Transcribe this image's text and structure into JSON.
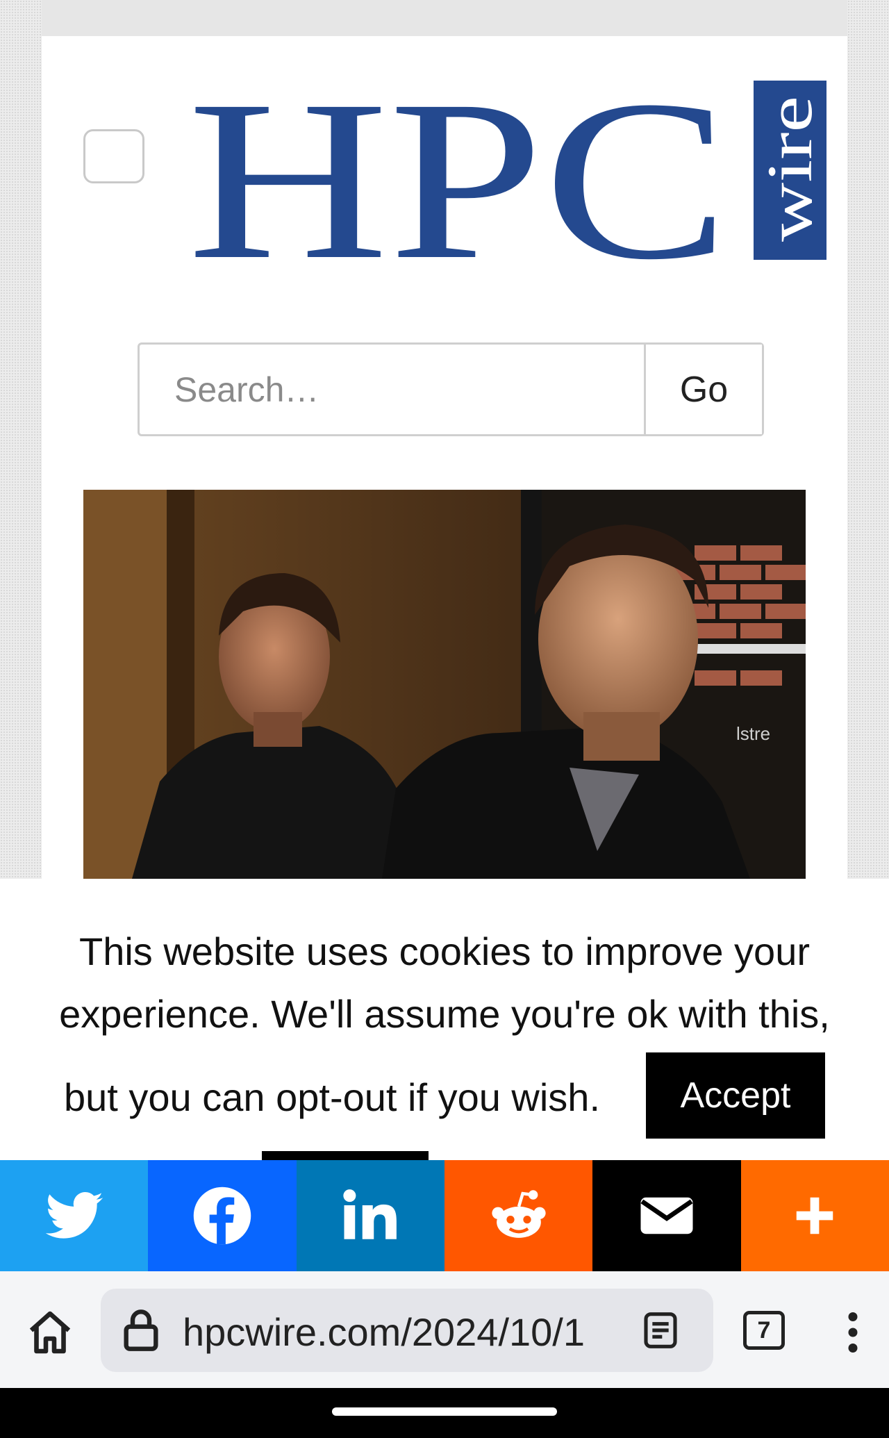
{
  "site": {
    "logo_main": "HPC",
    "logo_tag": "wire"
  },
  "search": {
    "placeholder": "Search…",
    "go_label": "Go"
  },
  "cookie": {
    "message_line1": "This website uses cookies to improve your",
    "message_line2": "experience. We'll assume you're ok with this,",
    "message_line3": "but you can opt-out if you wish.",
    "accept_label": "Accept"
  },
  "share": {
    "items": [
      {
        "icon": "twitter-icon",
        "color": "#1da1f2"
      },
      {
        "icon": "facebook-icon",
        "color": "#0866ff"
      },
      {
        "icon": "linkedin-icon",
        "color": "#0077b5"
      },
      {
        "icon": "reddit-icon",
        "color": "#ff5700"
      },
      {
        "icon": "email-icon",
        "color": "#000000"
      },
      {
        "icon": "plus-icon",
        "color": "#ff6a00"
      }
    ]
  },
  "browser": {
    "url": "hpcwire.com/2024/10/1",
    "tab_count": "7"
  },
  "colors": {
    "brand_blue": "#24498f",
    "accept_bg": "#000000"
  },
  "hero_photo": {
    "sign_text": "lstre"
  }
}
